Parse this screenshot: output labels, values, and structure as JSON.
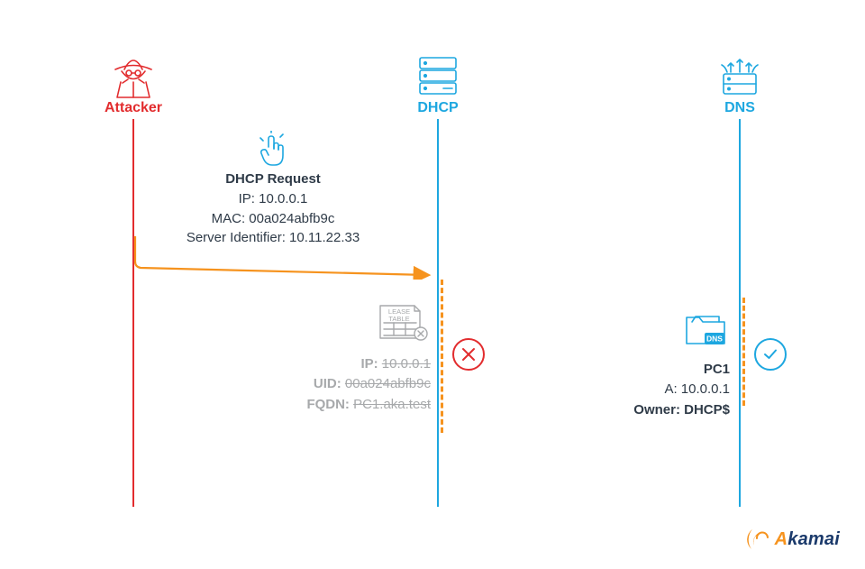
{
  "actors": {
    "attacker": {
      "label": "Attacker"
    },
    "dhcp": {
      "label": "DHCP"
    },
    "dns": {
      "label": "DNS"
    }
  },
  "request": {
    "title": "DHCP Request",
    "ip_line": "IP: 10.0.0.1",
    "mac_line": "MAC: 00a024abfb9c",
    "sid_line": "Server Identifier: 10.11.22.33"
  },
  "lease": {
    "icon_label_top": "LEASE",
    "icon_label_bottom": "TABLE",
    "ip_label": "IP:",
    "ip_value": "10.0.0.1",
    "uid_label": "UID:",
    "uid_value": "00a024abfb9c",
    "fqdn_label": "FQDN:",
    "fqdn_value": "PC1.aka.test"
  },
  "dns_record": {
    "folder_label": "DNS",
    "name": "PC1",
    "a_line": "A: 10.0.0.1",
    "owner_label": "Owner:",
    "owner_value": "DHCP$"
  },
  "logo": {
    "text": "Akamai"
  }
}
